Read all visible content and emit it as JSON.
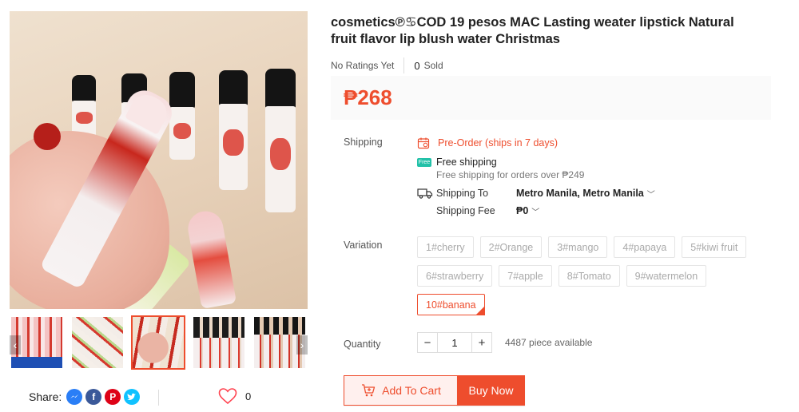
{
  "product": {
    "title": "cosmetics℗♋COD 19 pesos MAC Lasting weater lipstick Natural fruit flavor lip blush water Christmas",
    "ratings_text": "No Ratings Yet",
    "sold_count": "0",
    "sold_label": "Sold",
    "price": "₱268",
    "accent_color": "#ee4d2d"
  },
  "gallery": {
    "main_image": "lip-tint-product-photo",
    "thumbnails": [
      "thumb-1",
      "thumb-2",
      "thumb-3",
      "thumb-4",
      "thumb-5"
    ],
    "active_thumb": 2,
    "prev_arrow": "‹",
    "next_arrow": "›"
  },
  "share": {
    "label": "Share:",
    "networks": [
      "messenger",
      "facebook",
      "pinterest",
      "twitter"
    ],
    "favorite_count": "0"
  },
  "shipping": {
    "label": "Shipping",
    "pre_order": "Pre-Order (ships in 7 days)",
    "free_badge": "Free",
    "free_title": "Free shipping",
    "free_sub": "Free shipping for orders over ₱249",
    "ship_to_label": "Shipping To",
    "ship_to_value": "Metro Manila, Metro Manila",
    "fee_label": "Shipping Fee",
    "fee_value": "₱0"
  },
  "variation": {
    "label": "Variation",
    "options": [
      "1#cherry",
      "2#Orange",
      "3#mango",
      "4#papaya",
      "5#kiwi fruit",
      "6#strawberry",
      "7#apple",
      "8#Tomato",
      "9#watermelon",
      "10#banana"
    ],
    "selected": "10#banana"
  },
  "quantity": {
    "label": "Quantity",
    "value": "1",
    "minus": "−",
    "plus": "+",
    "available": "4487 piece available"
  },
  "actions": {
    "add_to_cart": "Add To Cart",
    "buy_now": "Buy Now"
  }
}
